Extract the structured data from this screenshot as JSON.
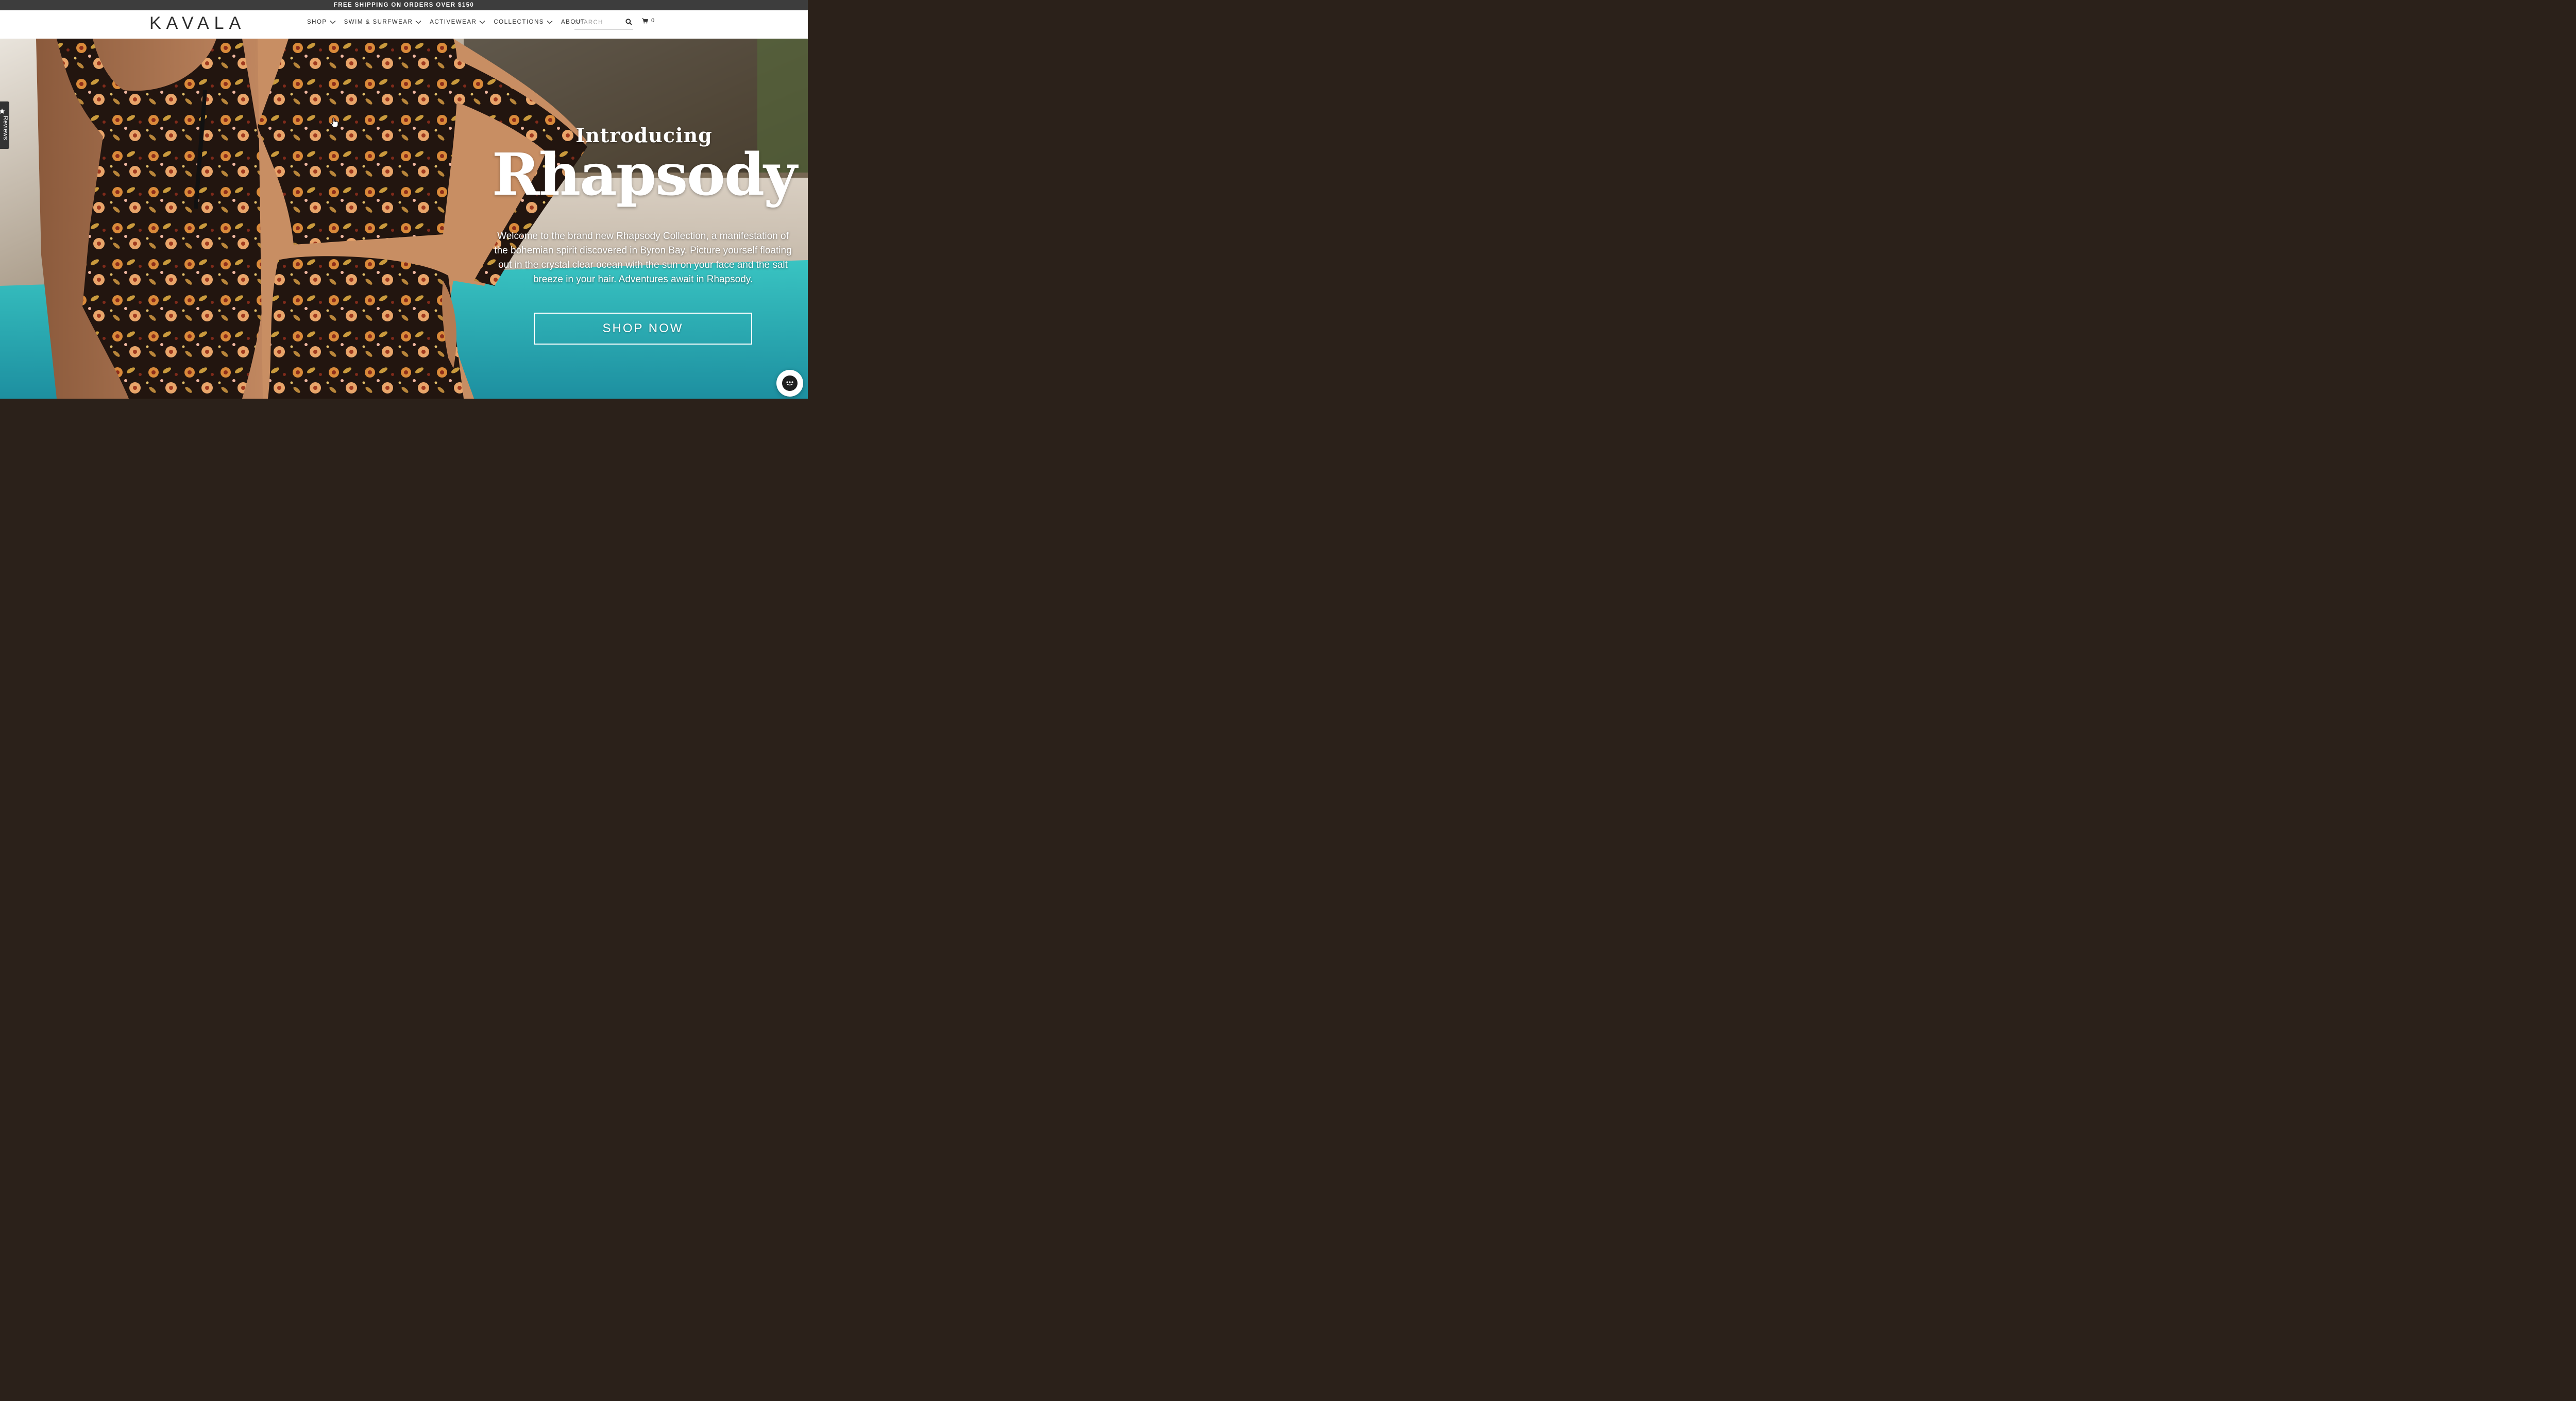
{
  "announcement": {
    "text": "FREE SHIPPING ON ORDERS OVER $150"
  },
  "header": {
    "logo_text": "KAVALA",
    "nav": [
      {
        "label": "SHOP",
        "has_dropdown": true
      },
      {
        "label": "SWIM & SURFWEAR",
        "has_dropdown": true
      },
      {
        "label": "ACTIVEWEAR",
        "has_dropdown": true
      },
      {
        "label": "COLLECTIONS",
        "has_dropdown": true
      },
      {
        "label": "ABOUT",
        "has_dropdown": false
      }
    ],
    "search": {
      "placeholder": "SEARCH",
      "value": "",
      "icon": "search-icon"
    },
    "cart": {
      "count": "0",
      "icon": "cart-icon"
    }
  },
  "hero": {
    "intro": "Introducing",
    "headline": "Rhapsody",
    "description": "Welcome to the brand new Rhapsody Collection, a manifestation of the bohemian spirit discovered in Byron Bay. Picture yourself floating out in the crystal clear ocean with the sun on your face and the salt breeze in your hair. Adventures await in Rhapsody.",
    "cta_label": "SHOP NOW"
  },
  "reviews_tab": {
    "label": "Reviews",
    "icon": "star-icon"
  },
  "chat": {
    "icon": "chat-icon"
  },
  "colors": {
    "announce_bg": "#3d3d3d",
    "header_bg": "#ffffff",
    "text_dark": "#333333",
    "hero_text": "#ffffff",
    "pool": "#2bb5b8"
  }
}
